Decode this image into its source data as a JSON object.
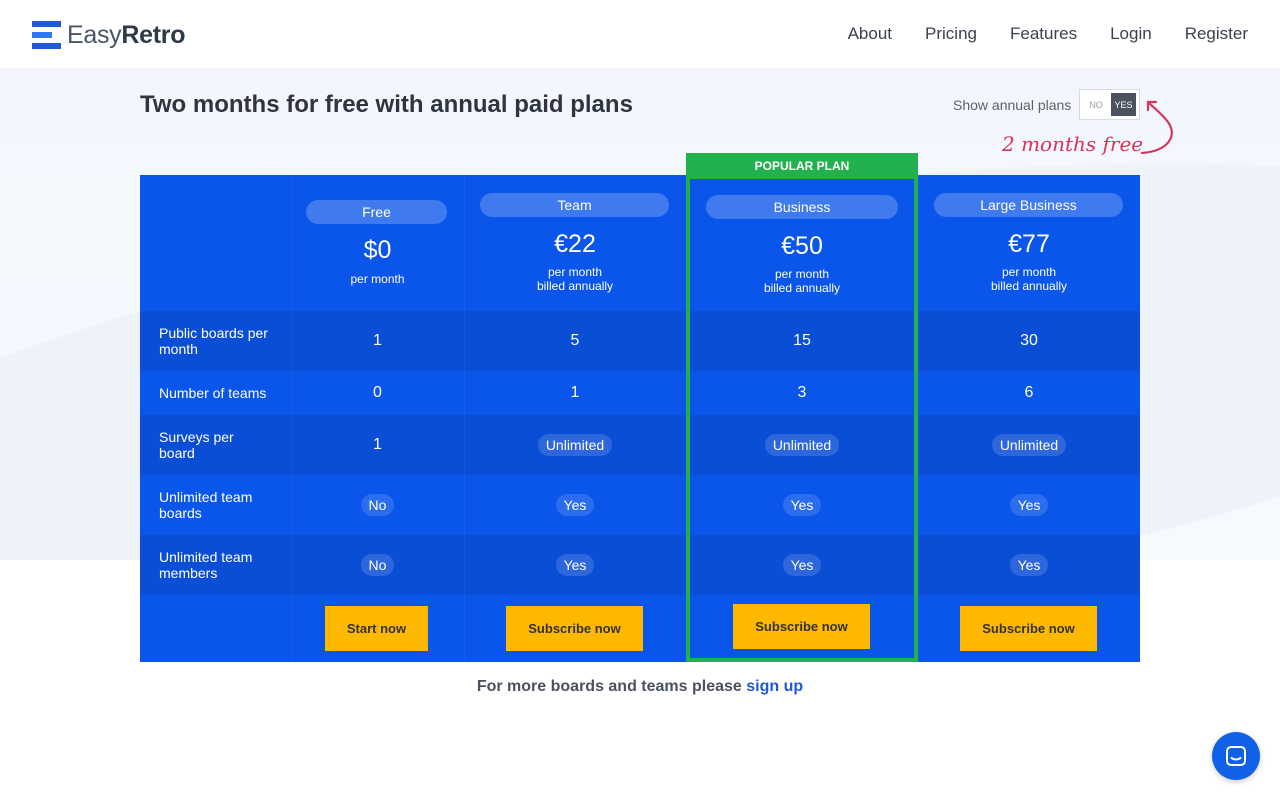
{
  "brand": {
    "name_light": "Easy",
    "name_bold": "Retro"
  },
  "nav": {
    "about": "About",
    "pricing": "Pricing",
    "features": "Features",
    "login": "Login",
    "register": "Register"
  },
  "headline": "Two months for free with annual paid plans",
  "annual": {
    "label": "Show annual plans",
    "no": "NO",
    "yes": "YES",
    "enabled": true,
    "note": "2 months free"
  },
  "popular_badge": "POPULAR PLAN",
  "plans": [
    {
      "name": "Free",
      "price": "$0",
      "period": "per month",
      "billing": "",
      "cta": "Start now"
    },
    {
      "name": "Team",
      "price": "€22",
      "period": "per month",
      "billing": "billed annually",
      "cta": "Subscribe now"
    },
    {
      "name": "Business",
      "price": "€50",
      "period": "per month",
      "billing": "billed annually",
      "cta": "Subscribe now"
    },
    {
      "name": "Large Business",
      "price": "€77",
      "period": "per month",
      "billing": "billed annually",
      "cta": "Subscribe now"
    }
  ],
  "features": [
    {
      "label": "Public boards per month",
      "values": [
        "1",
        "5",
        "15",
        "30"
      ]
    },
    {
      "label": "Number of teams",
      "values": [
        "0",
        "1",
        "3",
        "6"
      ]
    },
    {
      "label": "Surveys per board",
      "values": [
        "1",
        "Unlimited",
        "Unlimited",
        "Unlimited"
      ]
    },
    {
      "label": "Unlimited team boards",
      "values": [
        "No",
        "Yes",
        "Yes",
        "Yes"
      ]
    },
    {
      "label": "Unlimited team members",
      "values": [
        "No",
        "Yes",
        "Yes",
        "Yes"
      ]
    }
  ],
  "footer": {
    "text": "For more boards and teams please",
    "link": "sign up"
  },
  "colors": {
    "table_blue": "#0a55ea",
    "popular_green": "#22b14c",
    "cta_yellow": "#ffb800",
    "accent_red": "#d9345a"
  }
}
